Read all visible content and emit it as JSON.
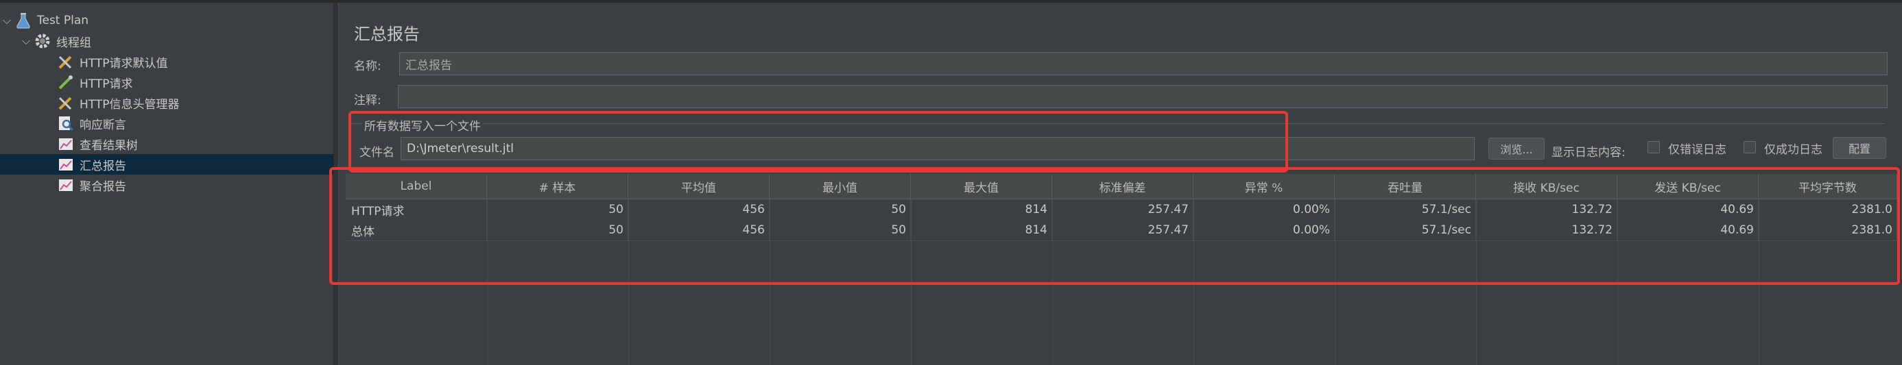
{
  "tree": {
    "items": [
      {
        "label": "Test Plan",
        "icon": "flask-icon"
      },
      {
        "label": "线程组",
        "icon": "gear-icon"
      },
      {
        "label": "HTTP请求默认值",
        "icon": "wrench-icon"
      },
      {
        "label": "HTTP请求",
        "icon": "pipette-icon"
      },
      {
        "label": "HTTP信息头管理器",
        "icon": "wrench-icon"
      },
      {
        "label": "响应断言",
        "icon": "magnifier-icon"
      },
      {
        "label": "查看结果树",
        "icon": "graph-icon"
      },
      {
        "label": "汇总报告",
        "icon": "graph-icon"
      },
      {
        "label": "聚合报告",
        "icon": "graph-icon"
      }
    ]
  },
  "panel": {
    "title": "汇总报告",
    "name_label": "名称:",
    "name_value": "汇总报告",
    "comment_label": "注释:",
    "comment_value": "",
    "group_title": "所有数据写入一个文件",
    "file_label": "文件名",
    "file_value": "D:\\Jmeter\\result.jtl",
    "browse_label": "浏览...",
    "log_label": "显示日志内容:",
    "errors_only_label": "仅错误日志",
    "success_only_label": "仅成功日志",
    "config_label": "配置"
  },
  "table": {
    "headers": [
      "Label",
      "# 样本",
      "平均值",
      "最小值",
      "最大值",
      "标准偏差",
      "异常 %",
      "吞吐量",
      "接收 KB/sec",
      "发送 KB/sec",
      "平均字节数"
    ],
    "rows": [
      [
        "HTTP请求",
        "50",
        "456",
        "50",
        "814",
        "257.47",
        "0.00%",
        "57.1/sec",
        "132.72",
        "40.69",
        "2381.0"
      ],
      [
        "总体",
        "50",
        "456",
        "50",
        "814",
        "257.47",
        "0.00%",
        "57.1/sec",
        "132.72",
        "40.69",
        "2381.0"
      ]
    ]
  },
  "colors": {
    "background": "#3c3f41",
    "selection": "#0d293e",
    "annotation": "#e53935"
  }
}
